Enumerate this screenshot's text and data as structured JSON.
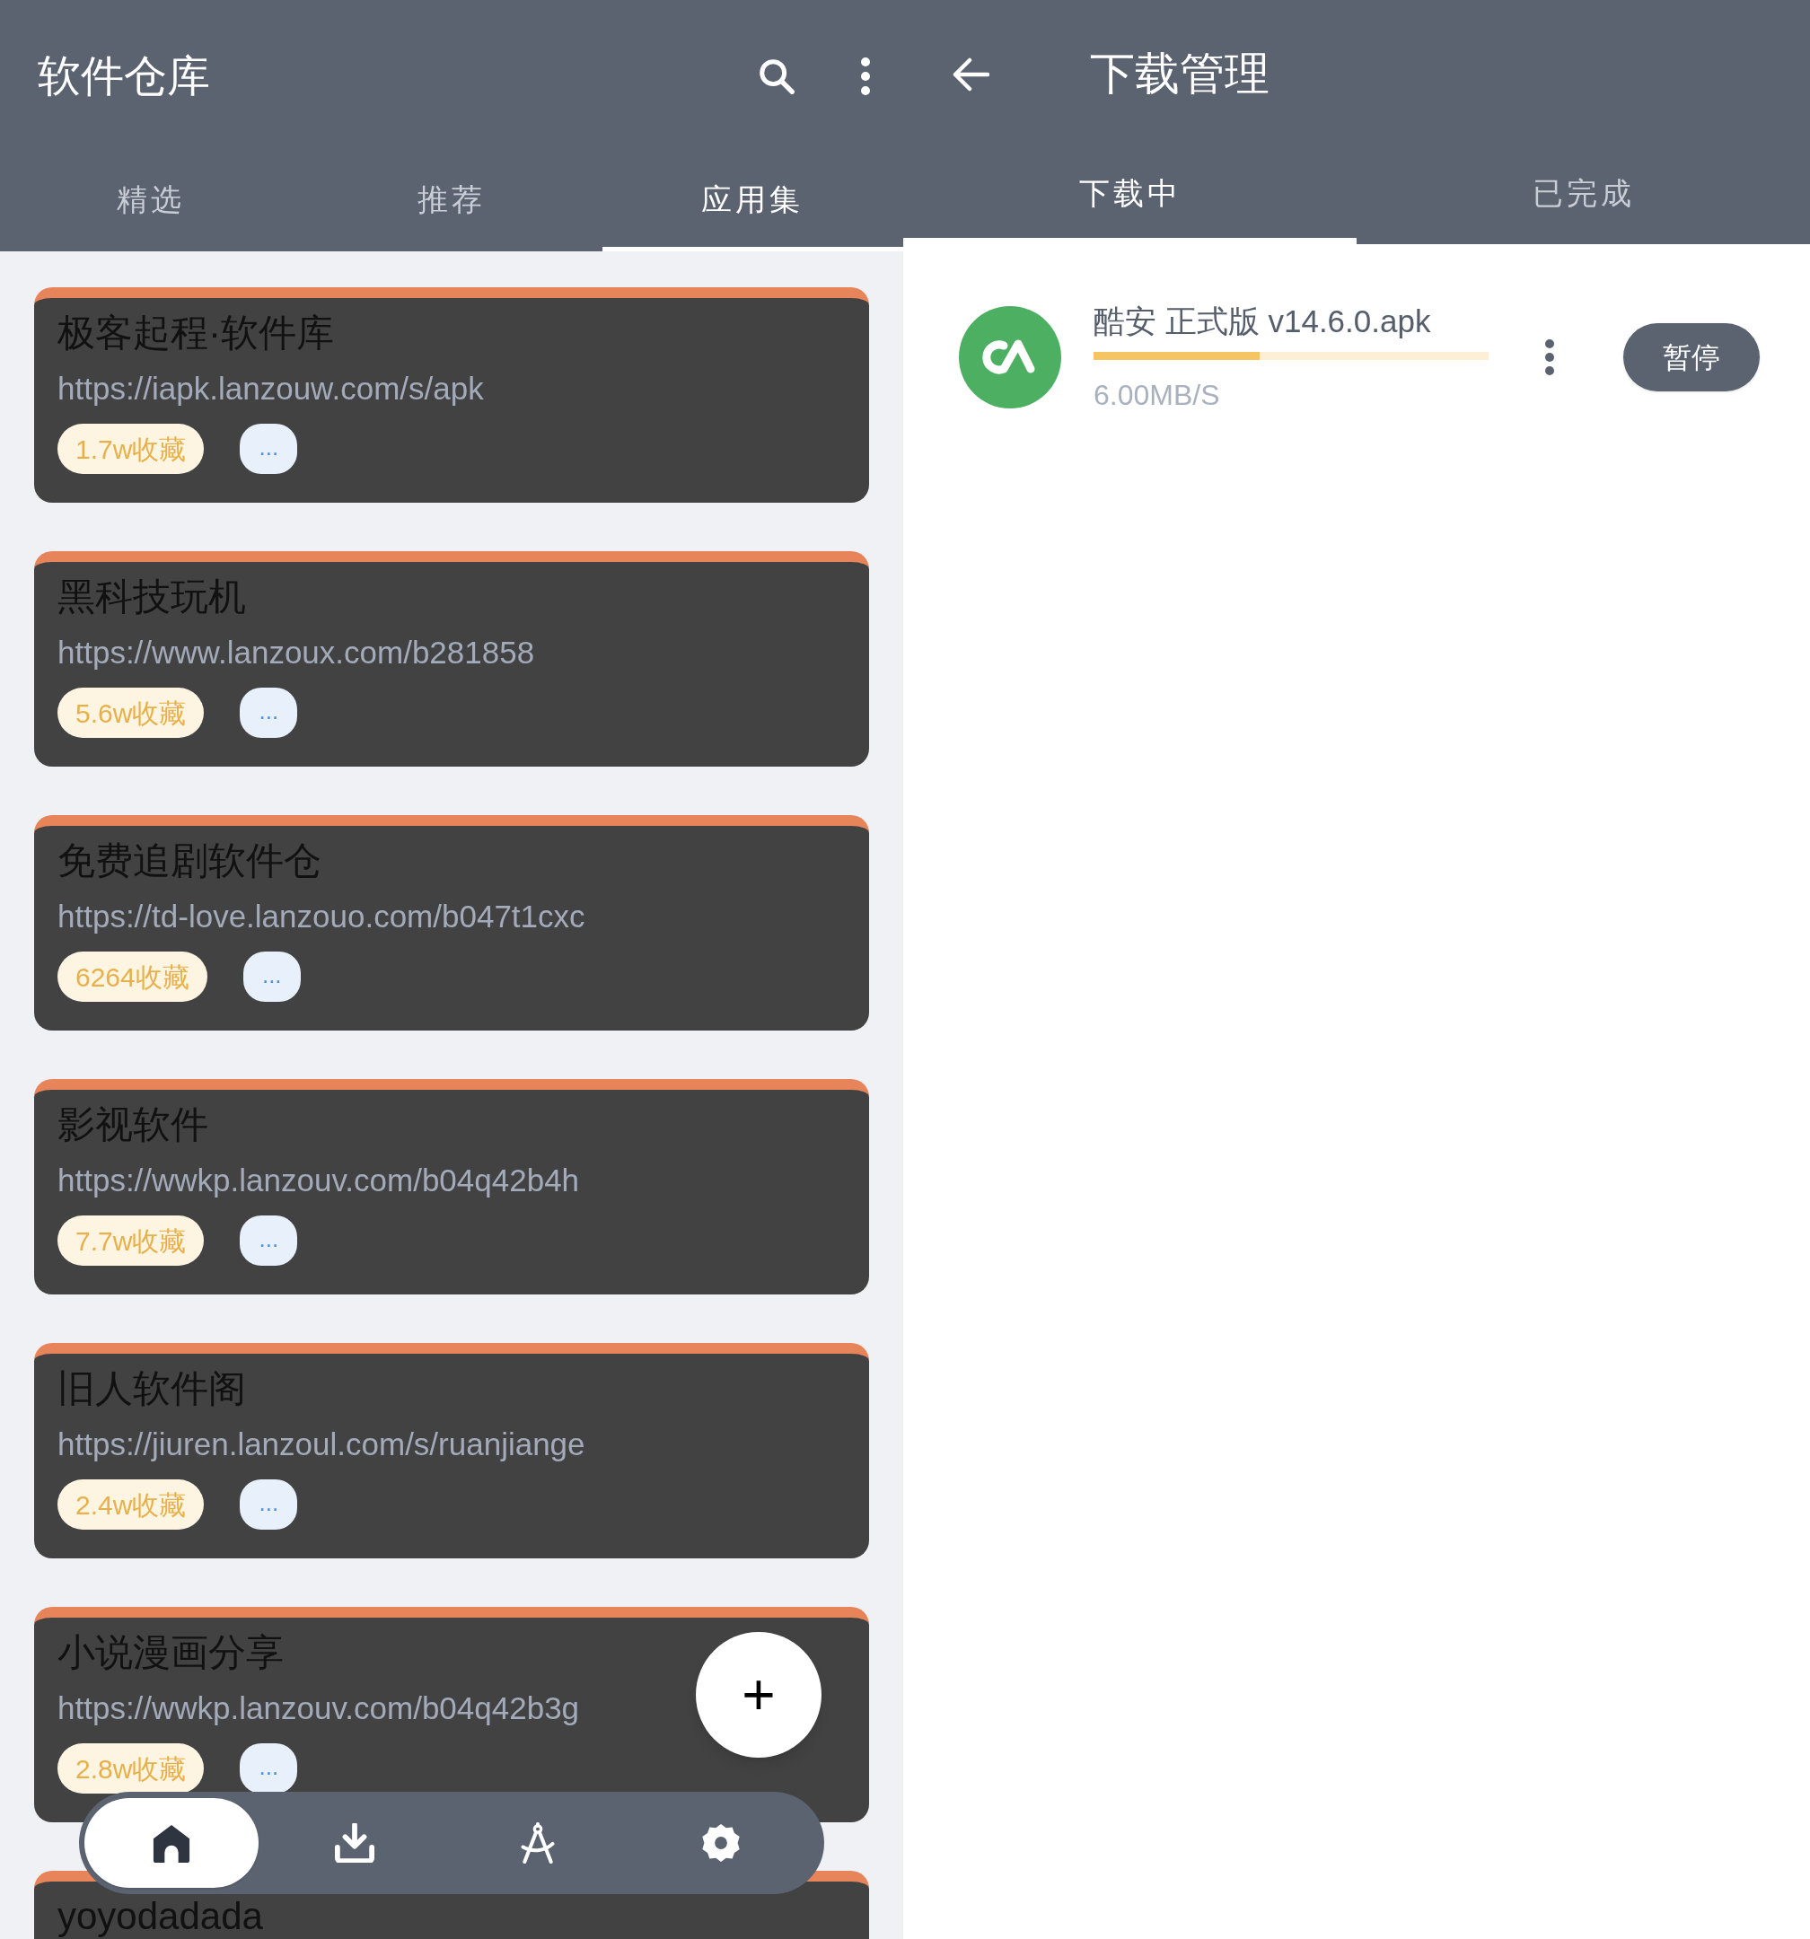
{
  "left": {
    "title": "软件仓库",
    "tabs": [
      {
        "label": "精选",
        "selected": false
      },
      {
        "label": "推荐",
        "selected": false
      },
      {
        "label": "应用集",
        "selected": true
      }
    ],
    "cards": [
      {
        "title": "极客起程·软件库",
        "url": "https://iapk.lanzouw.com/s/apk",
        "favorites": "1.7w收藏",
        "more": "..."
      },
      {
        "title": "黑科技玩机",
        "url": "https://www.lanzoux.com/b281858",
        "favorites": "5.6w收藏",
        "more": "..."
      },
      {
        "title": "免费追剧软件仓",
        "url": "https://td-love.lanzouo.com/b047t1cxc",
        "favorites": "6264收藏",
        "more": "..."
      },
      {
        "title": "影视软件",
        "url": "https://wwkp.lanzouv.com/b04q42b4h",
        "favorites": "7.7w收藏",
        "more": "..."
      },
      {
        "title": "旧人软件阁",
        "url": "https://jiuren.lanzoul.com/s/ruanjiange",
        "favorites": "2.4w收藏",
        "more": "..."
      },
      {
        "title": "小说漫画分享",
        "url": "https://wwkp.lanzouv.com/b04q42b3g",
        "favorites": "2.8w收藏",
        "more": "..."
      },
      {
        "title": "yoyodadada"
      }
    ],
    "fab": "+",
    "nav": [
      {
        "kind": "home",
        "selected": true
      },
      {
        "kind": "download",
        "selected": false
      },
      {
        "kind": "compass",
        "selected": false
      },
      {
        "kind": "settings",
        "selected": false
      }
    ]
  },
  "right": {
    "title": "下载管理",
    "tabs": [
      {
        "label": "下载中",
        "selected": true
      },
      {
        "label": "已完成",
        "selected": false
      }
    ],
    "downloads": [
      {
        "name": "酷安 正式版 v14.6.0.apk",
        "level": 0.42,
        "speed": "6.00MB/S",
        "button": "暂停"
      }
    ]
  }
}
